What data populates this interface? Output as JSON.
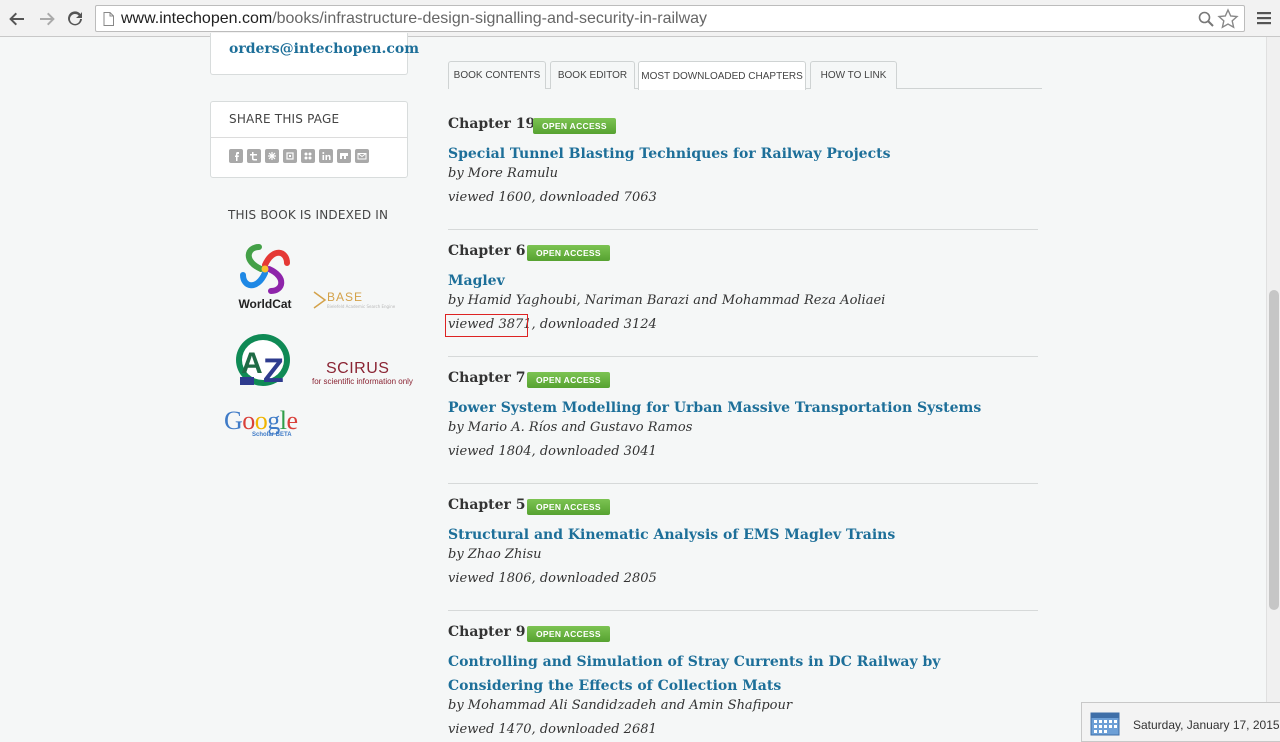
{
  "browser": {
    "url_domain": "www.intechopen.com",
    "url_path": "/books/infrastructure-design-signalling-and-security-in-railway"
  },
  "sidebar": {
    "contact_email": "orders@intechopen.com",
    "share_title": "SHARE THIS PAGE",
    "share_icons": [
      "facebook-icon",
      "twitter-icon",
      "delicious-icon",
      "digg-icon",
      "stumbleupon-icon",
      "linkedin-icon",
      "mixx-icon",
      "email-icon"
    ],
    "indexed_title": "THIS BOOK IS INDEXED IN",
    "logos": {
      "worldcat": "WorldCat",
      "base": "BASE",
      "base_sub": "Bielefeld Academic Search Engine",
      "scirus": "SCIRUS",
      "scirus_sub": "for scientific information only",
      "google": "Google",
      "google_sub": "Scholar BETA"
    }
  },
  "tabs": [
    {
      "label": "BOOK CONTENTS",
      "active": false
    },
    {
      "label": "BOOK EDITOR",
      "active": false
    },
    {
      "label": "MOST DOWNLOADED CHAPTERS",
      "active": true
    },
    {
      "label": "HOW TO LINK",
      "active": false
    }
  ],
  "badge_label": "OPEN ACCESS",
  "chapters": [
    {
      "label": "Chapter 19",
      "title": "Special Tunnel Blasting Techniques for Railway Projects",
      "authors": "by More Ramulu",
      "stats": "viewed 1600, downloaded 7063"
    },
    {
      "label": "Chapter 6",
      "title": "Maglev",
      "authors": "by Hamid Yaghoubi, Nariman Barazi and Mohammad Reza Aoliaei",
      "stats": "viewed 3871, downloaded 3124"
    },
    {
      "label": "Chapter 7",
      "title": "Power System Modelling for Urban Massive Transportation Systems",
      "authors": "by Mario A. Ríos and Gustavo Ramos",
      "stats": "viewed 1804, downloaded 3041"
    },
    {
      "label": "Chapter 5",
      "title": "Structural and Kinematic Analysis of EMS Maglev Trains",
      "authors": "by Zhao Zhisu",
      "stats": "viewed 1806, downloaded 2805"
    },
    {
      "label": "Chapter 9",
      "title": "Controlling and Simulation of Stray Currents in DC Railway by Considering the Effects of Collection Mats",
      "authors": "by Mohammad Ali Sandidzadeh and Amin Shafipour",
      "stats": "viewed 1470, downloaded 2681"
    }
  ],
  "tray": {
    "date": "Saturday, January 17, 2015"
  },
  "colors": {
    "link": "#1d6f99",
    "badge": "#5faa3a",
    "highlight": "#dd2222"
  }
}
